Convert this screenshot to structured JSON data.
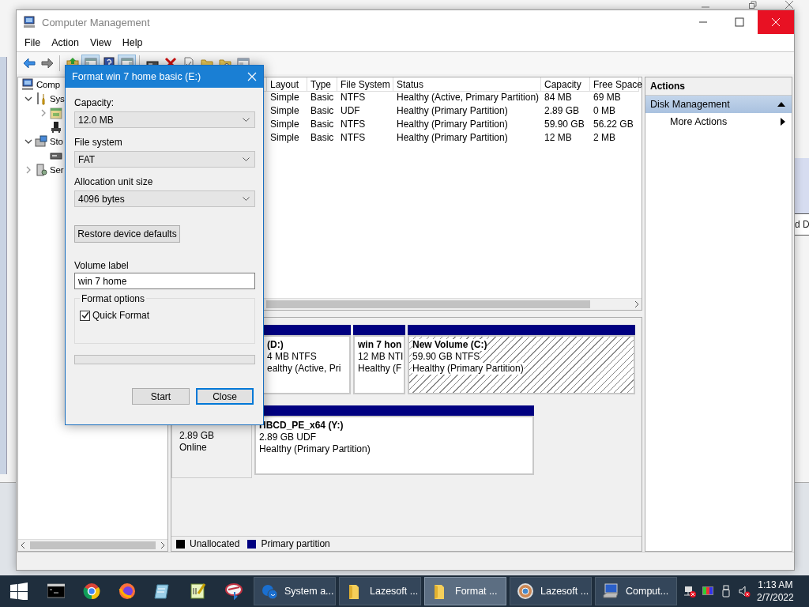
{
  "background_window": {
    "text": "d D"
  },
  "window": {
    "title": "Computer Management",
    "close_hovered": true
  },
  "menu": [
    "File",
    "Action",
    "View",
    "Help"
  ],
  "toolbar": [
    [
      {
        "kind": "back",
        "pressed": false
      },
      {
        "kind": "forward",
        "pressed": false
      }
    ],
    [
      {
        "kind": "up",
        "pressed": false
      },
      {
        "kind": "tree",
        "pressed": true
      },
      {
        "kind": "help",
        "pressed": false
      },
      {
        "kind": "pane",
        "pressed": true
      }
    ],
    [
      {
        "kind": "drive",
        "pressed": false
      },
      {
        "kind": "delete",
        "pressed": false
      },
      {
        "kind": "properties",
        "pressed": false
      },
      {
        "kind": "folder",
        "pressed": false
      },
      {
        "kind": "folder-search",
        "pressed": false
      },
      {
        "kind": "window",
        "pressed": false
      }
    ]
  ],
  "tree": [
    {
      "kind": "computer",
      "label": "Comp",
      "children": [
        {
          "kind": "tools",
          "label": "Sys",
          "expanded": true,
          "children": [
            {
              "kind": "calendar",
              "expanded": false
            },
            {
              "kind": "device"
            }
          ]
        },
        {
          "kind": "storage",
          "label": "Sto",
          "expanded": true,
          "children": [
            {
              "kind": "drive"
            }
          ]
        },
        {
          "kind": "services",
          "label": "Ser",
          "expanded": false
        }
      ]
    }
  ],
  "volume_table": {
    "columns": [
      "Layout",
      "Type",
      "File System",
      "Status",
      "Capacity",
      "Free Space"
    ],
    "rows": [
      [
        "Simple",
        "Basic",
        "NTFS",
        "Healthy (Active, Primary Partition)",
        "84 MB",
        "69 MB"
      ],
      [
        "Simple",
        "Basic",
        "UDF",
        "Healthy (Primary Partition)",
        "2.89 GB",
        "0 MB"
      ],
      [
        "Simple",
        "Basic",
        "NTFS",
        "Healthy (Primary Partition)",
        "59.90 GB",
        "56.22 GB"
      ],
      [
        "Simple",
        "Basic",
        "NTFS",
        "Healthy (Primary Partition)",
        "12 MB",
        "2 MB"
      ]
    ]
  },
  "disk_view": {
    "disks": [
      {
        "partitions": [
          {
            "name": "(D:)",
            "size": "4 MB NTFS",
            "status": "ealthy (Active, Pri",
            "selected": false
          },
          {
            "name": "win 7 hon",
            "size": "12 MB NTI",
            "status": "Healthy (F",
            "selected": false
          },
          {
            "name": "New Volume  (C:)",
            "size": "59.90 GB NTFS",
            "status": "Healthy (Primary Partition)",
            "selected": true
          }
        ]
      },
      {
        "info": [
          "2.89 GB",
          "Online"
        ],
        "partitions": [
          {
            "name": "HBCD_PE_x64  (Y:)",
            "size": "2.89 GB UDF",
            "status": "Healthy (Primary Partition)",
            "selected": false
          }
        ]
      }
    ],
    "legend": [
      {
        "label": "Unallocated",
        "color": "#000000"
      },
      {
        "label": "Primary partition",
        "color": "#000080"
      }
    ]
  },
  "actions": {
    "title": "Actions",
    "sections": [
      {
        "label": "Disk Management",
        "expanded": true,
        "items": [
          "More Actions"
        ]
      }
    ]
  },
  "dialog": {
    "title": "Format win 7 home basic (E:)",
    "dropdowns": [
      {
        "label": "Capacity:",
        "value": "12.0 MB"
      },
      {
        "label": "File system",
        "value": "FAT"
      },
      {
        "label": "Allocation unit size",
        "value": "4096 bytes"
      }
    ],
    "restore_button": "Restore device defaults",
    "volume_label": {
      "label": "Volume label",
      "value": "win 7 home"
    },
    "format_options": {
      "title": "Format options",
      "quick_format": {
        "label": "Quick Format",
        "checked": true
      }
    },
    "progress": {
      "level": 0
    },
    "buttons": [
      {
        "label": "Start",
        "default": false
      },
      {
        "label": "Close",
        "default": true
      }
    ]
  },
  "taskbar": {
    "pinned": [
      {
        "kind": "start"
      },
      {
        "kind": "terminal"
      },
      {
        "kind": "ring-browser"
      },
      {
        "kind": "fox-browser"
      },
      {
        "kind": "notepad"
      },
      {
        "kind": "editor"
      },
      {
        "kind": "disc-tool"
      }
    ],
    "tasks": [
      {
        "kind": "system",
        "label": "System a...",
        "selected": false
      },
      {
        "kind": "folder",
        "label": "Lazesoft ...",
        "selected": false
      },
      {
        "kind": "folder",
        "label": "Format ...",
        "selected": true
      },
      {
        "kind": "disc",
        "label": "Lazesoft ...",
        "selected": false
      },
      {
        "kind": "computer",
        "label": "Comput...",
        "selected": false
      }
    ],
    "tray": [
      {
        "kind": "network-off"
      },
      {
        "kind": "color"
      },
      {
        "kind": "usb"
      },
      {
        "kind": "volume-muted"
      }
    ],
    "time": "1:13 AM",
    "date": "2/7/2022"
  }
}
